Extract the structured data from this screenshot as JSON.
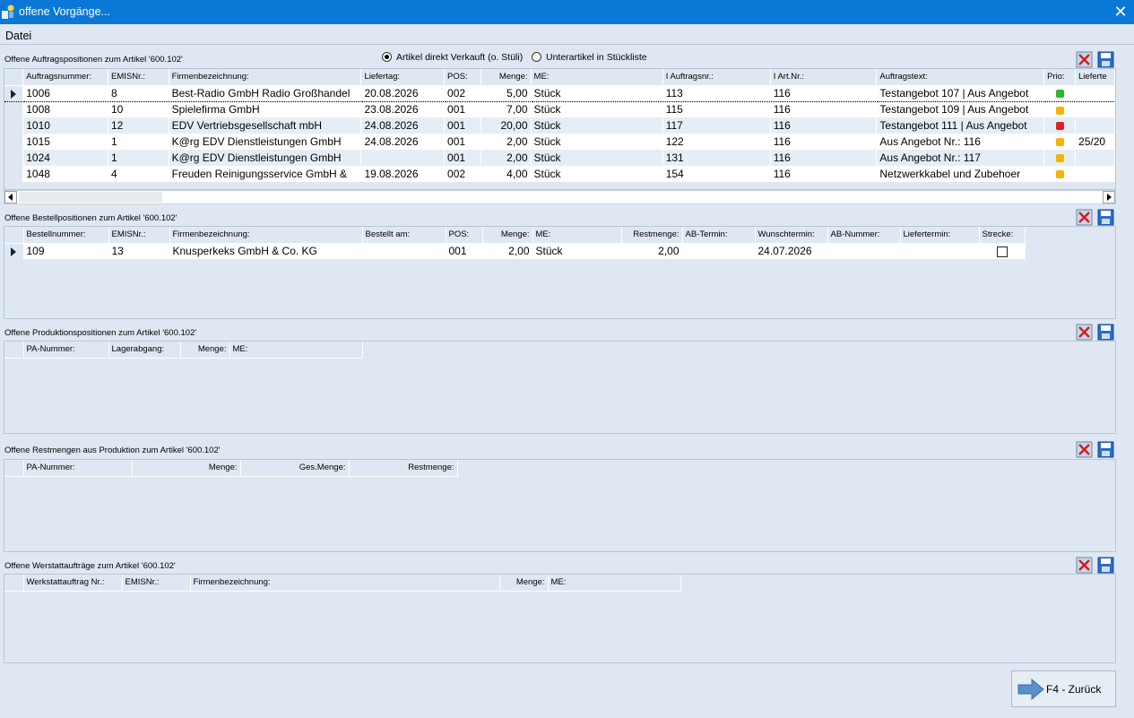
{
  "window": {
    "title": "offene Vorgänge...",
    "close_glyph": "✕"
  },
  "menu": {
    "datei": "Datei"
  },
  "radio": {
    "option1": "Artikel direkt Verkauft (o. Stüli)",
    "option2": "Unterartikel in Stückliste",
    "selected": 1
  },
  "auftrag": {
    "title": "Offene Auftragspositionen zum Artikel '600.102'",
    "columns": [
      "Auftragsnummer:",
      "EMISNr.:",
      "Firmenbezeichnung:",
      "Liefertag:",
      "POS:",
      "Menge:",
      "ME:",
      "I Auftragsnr.:",
      "I Art.Nr.:",
      "Auftragstext:",
      "Prio:",
      "Lieferte"
    ],
    "rows": [
      {
        "nr": "1006",
        "emis": "8",
        "firma": "Best-Radio GmbH Radio Großhandel",
        "liefertag": "20.08.2026",
        "pos": "002",
        "menge": "5,00",
        "me": "Stück",
        "iauftrag": "113",
        "iart": "116",
        "text": "Testangebot 107 | Aus Angebot",
        "prio": "green",
        "lief": ""
      },
      {
        "nr": "1008",
        "emis": "10",
        "firma": "Spielefirma GmbH",
        "liefertag": "23.08.2026",
        "pos": "001",
        "menge": "7,00",
        "me": "Stück",
        "iauftrag": "115",
        "iart": "116",
        "text": "Testangebot 109 | Aus Angebot",
        "prio": "yellow",
        "lief": ""
      },
      {
        "nr": "1010",
        "emis": "12",
        "firma": "EDV Vertriebsgesellschaft mbH",
        "liefertag": "24.08.2026",
        "pos": "001",
        "menge": "20,00",
        "me": "Stück",
        "iauftrag": "117",
        "iart": "116",
        "text": "Testangebot 111 | Aus Angebot",
        "prio": "red",
        "lief": ""
      },
      {
        "nr": "1015",
        "emis": "1",
        "firma": "K@rg EDV Dienstleistungen GmbH",
        "liefertag": "24.08.2026",
        "pos": "001",
        "menge": "2,00",
        "me": "Stück",
        "iauftrag": "122",
        "iart": "116",
        "text": "Aus Angebot Nr.: 116",
        "prio": "yellow",
        "lief": "25/20"
      },
      {
        "nr": "1024",
        "emis": "1",
        "firma": "K@rg EDV Dienstleistungen GmbH",
        "liefertag": "",
        "pos": "001",
        "menge": "2,00",
        "me": "Stück",
        "iauftrag": "131",
        "iart": "116",
        "text": "Aus Angebot Nr.: 117",
        "prio": "yellow",
        "lief": ""
      },
      {
        "nr": "1048",
        "emis": "4",
        "firma": "Freuden Reinigungsservice GmbH &",
        "liefertag": "19.08.2026",
        "pos": "002",
        "menge": "4,00",
        "me": "Stück",
        "iauftrag": "154",
        "iart": "116",
        "text": "Netzwerkkabel und Zubehoer",
        "prio": "yellow",
        "lief": ""
      }
    ]
  },
  "bestell": {
    "title": "Offene Bestellpositionen zum Artikel '600.102'",
    "columns": [
      "Bestellnummer:",
      "EMISNr.:",
      "Firmenbezeichnung:",
      "Bestellt am:",
      "POS:",
      "Menge:",
      "ME:",
      "Restmenge:",
      "AB-Termin:",
      "Wunschtermin:",
      "AB-Nummer:",
      "Liefertermin:",
      "Strecke:"
    ],
    "rows": [
      {
        "nr": "109",
        "emis": "13",
        "firma": "Knusperkeks GmbH & Co. KG",
        "bestellt": "",
        "pos": "001",
        "menge": "2,00",
        "me": "Stück",
        "rest": "2,00",
        "ab": "",
        "wunsch": "24.07.2026",
        "abnr": "",
        "liefer": "",
        "strecke": false
      }
    ]
  },
  "produktion": {
    "title": "Offene Produktionspositionen zum Artikel '600.102'",
    "columns": [
      "PA-Nummer:",
      "Lagerabgang:",
      "Menge:",
      "ME:"
    ]
  },
  "rest": {
    "title": "Offene Restmengen aus Produktion zum Artikel '600.102'",
    "columns": [
      "PA-Nummer:",
      "Menge:",
      "Ges.Menge:",
      "Restmenge:"
    ]
  },
  "werkstatt": {
    "title": "Offene Werstattaufträge zum Artikel '600.102'",
    "columns": [
      "Werkstattauftrag Nr.:",
      "EMISNr.:",
      "Firmenbezeichnung:",
      "Menge:",
      "ME:"
    ]
  },
  "buttons": {
    "back": "F4 - Zurück"
  },
  "colors": {
    "titlebar": "#0a78d7",
    "prio_green": "#2db52d",
    "prio_yellow": "#f4b400",
    "prio_red": "#e02020"
  },
  "icons": {
    "delete": "delete-x-icon",
    "save": "save-disk-icon",
    "arrow": "arrow-right-icon"
  }
}
